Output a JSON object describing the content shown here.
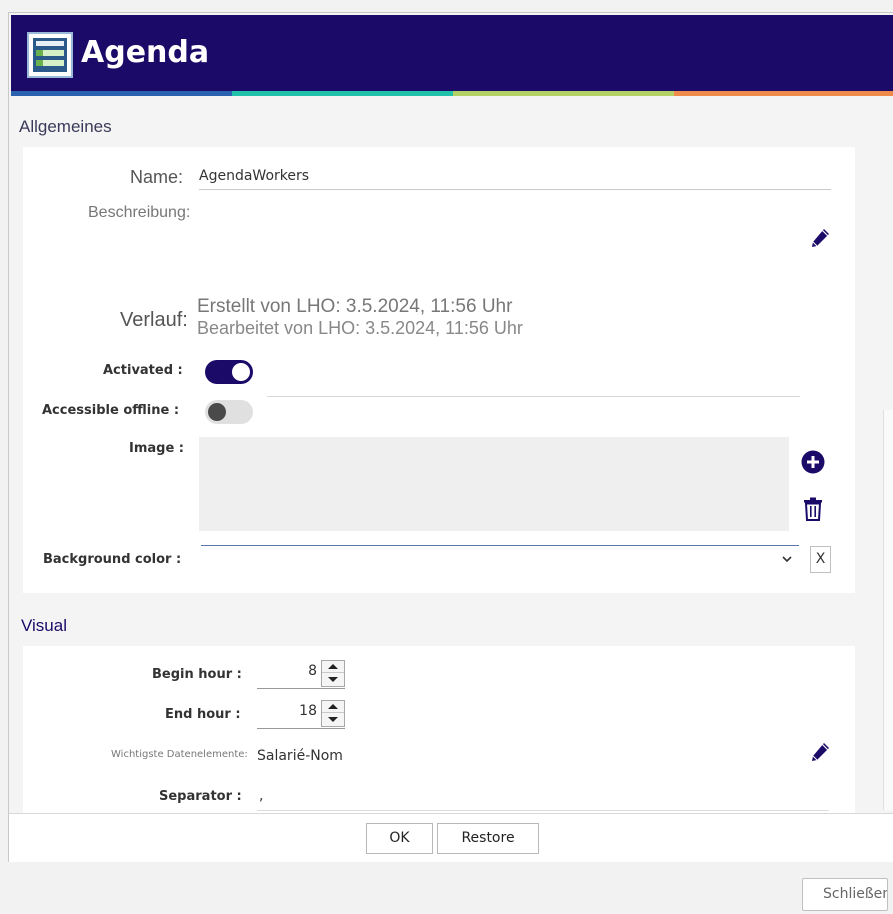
{
  "window": {
    "title": "Agenda",
    "icon": "agenda-app-icon"
  },
  "sections": {
    "general": "Allgemeines",
    "visual": "Visual"
  },
  "general": {
    "name_label": "Name:",
    "name_value": "AgendaWorkers",
    "description_label": "Beschreibung:",
    "history_label": "Verlauf:",
    "history_created": "Erstellt von LHO: 3.5.2024, 11:56 Uhr",
    "history_edited": "Bearbeitet von LHO: 3.5.2024, 11:56 Uhr",
    "activated_label": "Activated :",
    "activated": true,
    "offline_label": "Accessible offline :",
    "offline": false,
    "image_label": "Image :",
    "bgcolor_label": "Background color :",
    "bgcolor_clear": "X"
  },
  "visual": {
    "begin_hour_label": "Begin hour :",
    "begin_hour": "8",
    "end_hour_label": "End hour :",
    "end_hour": "18",
    "key_fields_label": "Wichtigste Datenelemente:",
    "key_fields_value": "Salarié-Nom",
    "separator_label": "Separator :",
    "separator_value": ","
  },
  "footer": {
    "ok": "OK",
    "restore": "Restore"
  },
  "close_button": "Schließen",
  "colors": {
    "titlebar": "#1c0a68",
    "stripe": [
      "#2a62b0",
      "#1fc1a8",
      "#b3d165",
      "#f08a4b"
    ],
    "accent": "#1c0a68"
  }
}
